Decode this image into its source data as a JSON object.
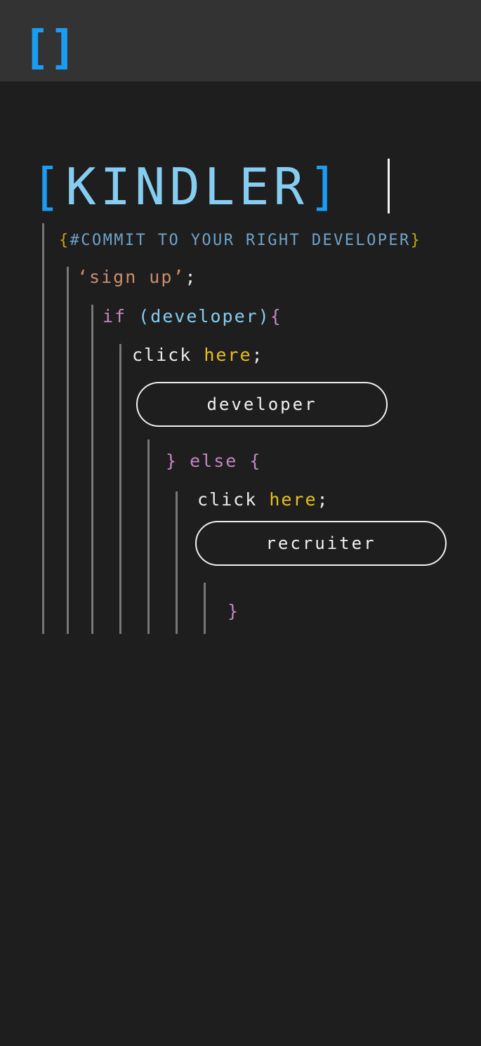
{
  "header": {
    "logo_text": "[]"
  },
  "brand": {
    "open_bracket": "[",
    "name": "KINDLER",
    "close_bracket": "]"
  },
  "tagline": {
    "open": "{",
    "text": "#COMMIT TO YOUR RIGHT DEVELOPER",
    "close": "}"
  },
  "code": {
    "signup_string": "‘sign up’",
    "signup_semi": ";",
    "if_keyword": "if ",
    "if_arg": "(developer)",
    "if_open": "{",
    "click_text": "click ",
    "click_highlight": "here",
    "click_semi": ";",
    "else_text": "} else {",
    "close_brace": "}"
  },
  "buttons": {
    "developer_label": "developer",
    "recruiter_label": "recruiter"
  },
  "colors": {
    "background": "#1e1e1e",
    "header": "#333333",
    "accent_blue": "#1a9cf0",
    "light_blue": "#86cdf2",
    "keyword_purple": "#c586c0",
    "string_orange": "#cc8e6c",
    "highlight_yellow": "#e8c01a",
    "guide_line": "#777777"
  }
}
